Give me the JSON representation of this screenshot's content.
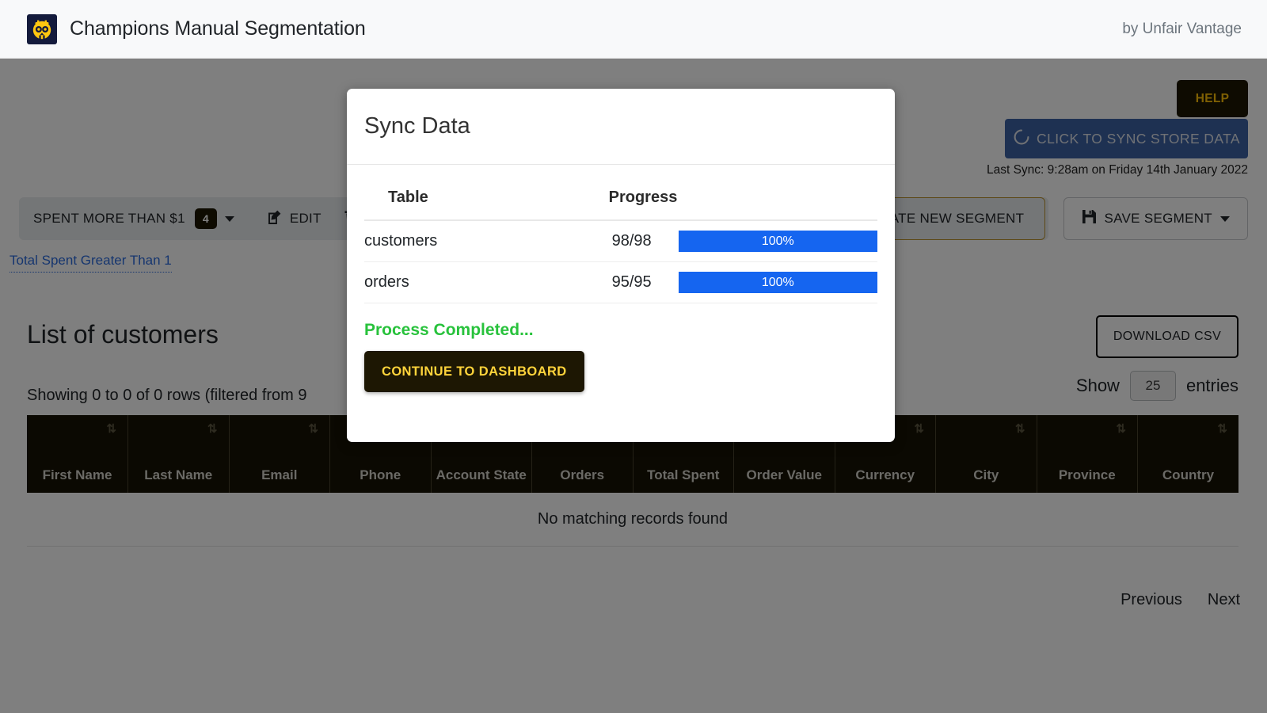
{
  "navbar": {
    "logo_icon": "owl-logo-icon",
    "title": "Champions Manual Segmentation",
    "byline": "by Unfair Vantage"
  },
  "actions": {
    "help_label": "HELP",
    "sync_label": "CLICK TO SYNC STORE DATA",
    "sync_icon": "spinner-icon",
    "last_sync": "Last Sync: 9:28am on Friday 14th January 2022"
  },
  "segment_toolbar": {
    "segment_name": "SPENT MORE THAN $1",
    "segment_count": "4",
    "dropdown_icon": "chevron-down-icon",
    "edit_label": "EDIT",
    "edit_icon": "pencil-square-icon",
    "delete_icon": "trash-icon",
    "create_label": "CREATE NEW SEGMENT",
    "save_label": "SAVE SEGMENT",
    "save_icon": "floppy-disk-icon",
    "save_caret_icon": "caret-down-icon"
  },
  "filter_chip": {
    "label": "Total Spent Greater Than 1"
  },
  "customers": {
    "heading": "List of customers",
    "showing_text": "Showing 0 to 0 of 0 rows (filtered from 9",
    "download_label": "DOWNLOAD CSV",
    "show_label": "Show",
    "entries_value": "25",
    "entries_label": "entries",
    "sort_icon": "sort-updown-icon",
    "columns": [
      "First Name",
      "Last Name",
      "Email",
      "Phone",
      "Account State",
      "Orders",
      "Total Spent",
      "Order Value",
      "Currency",
      "City",
      "Province",
      "Country"
    ],
    "empty_message": "No matching records found",
    "pagination": {
      "previous": "Previous",
      "next": "Next"
    }
  },
  "modal": {
    "title": "Sync Data",
    "col_table": "Table",
    "col_progress": "Progress",
    "rows": [
      {
        "table": "customers",
        "count": "98/98",
        "percent_label": "100%",
        "percent": 100
      },
      {
        "table": "orders",
        "count": "95/95",
        "percent_label": "100%",
        "percent": 100
      }
    ],
    "status_message": "Process Completed...",
    "continue_label": "CONTINUE TO DASHBOARD"
  },
  "colors": {
    "accent_yellow": "#ffc107",
    "dark_button": "#1d1703",
    "progress_blue": "#1565f0",
    "success_green": "#28c23c",
    "sync_blue": "#3c62a4",
    "link_blue": "#2d6cdf"
  }
}
